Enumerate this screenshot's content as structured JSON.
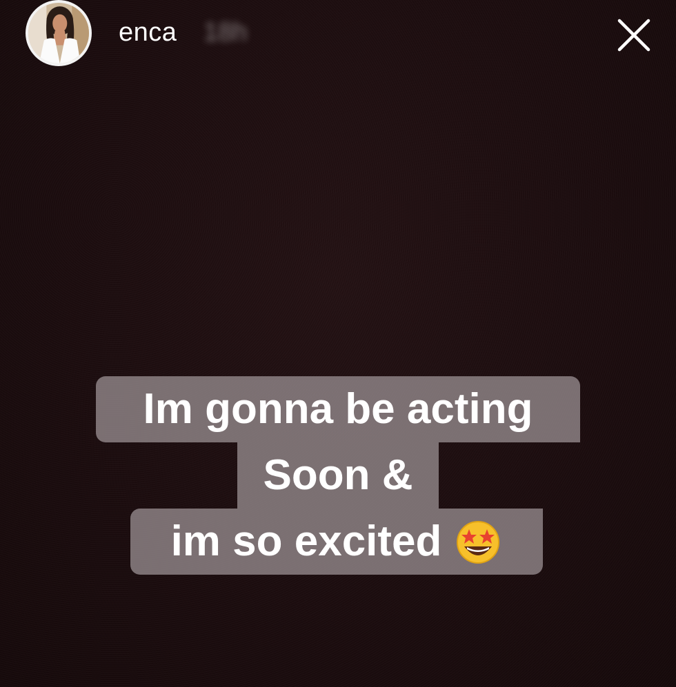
{
  "story": {
    "username": "enca",
    "timestamp": "18h",
    "close_icon": "close-icon",
    "avatar_icon": "avatar-photo"
  },
  "caption": {
    "line1": "Im gonna be acting",
    "line2": "Soon &",
    "line3": "im so excited",
    "emoji": "star-struck-emoji",
    "box_color": "#968c8e",
    "text_color": "#ffffff"
  },
  "colors": {
    "background": "#1c0d0f",
    "accent": "#ffffff"
  }
}
